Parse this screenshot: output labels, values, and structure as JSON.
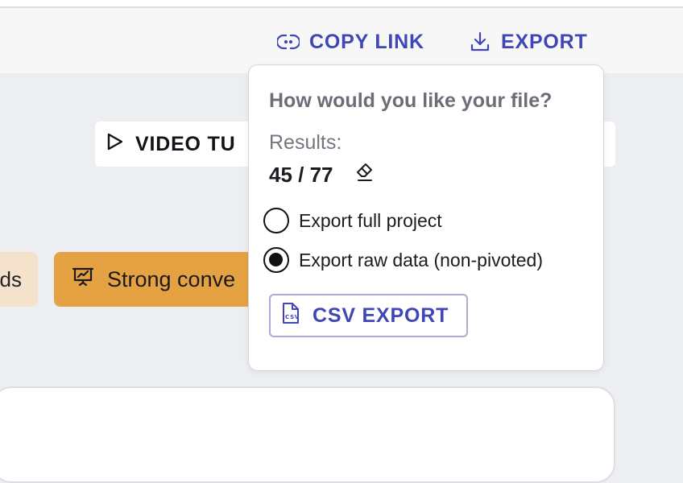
{
  "toolbar": {
    "copy_link_label": "COPY LINK",
    "export_label": "EXPORT",
    "accent_color": "#3f46b5"
  },
  "background": {
    "video_tutorial_label": "VIDEO TU",
    "chip_left_label": "ds",
    "chip_right_label": "Strong conve"
  },
  "export_popover": {
    "title": "How would you like your file?",
    "results_label": "Results:",
    "results_value": "45 / 77",
    "options": [
      {
        "label": "Export full project",
        "selected": false
      },
      {
        "label": "Export raw data (non-pivoted)",
        "selected": true
      }
    ],
    "csv_button_label": "CSV EXPORT"
  },
  "icons": {
    "copy_link": "link-icon",
    "export": "download-icon",
    "video": "play-icon",
    "chip": "presentation-chart-icon",
    "results_edit": "eraser-icon",
    "csv": "csv-file-icon"
  }
}
